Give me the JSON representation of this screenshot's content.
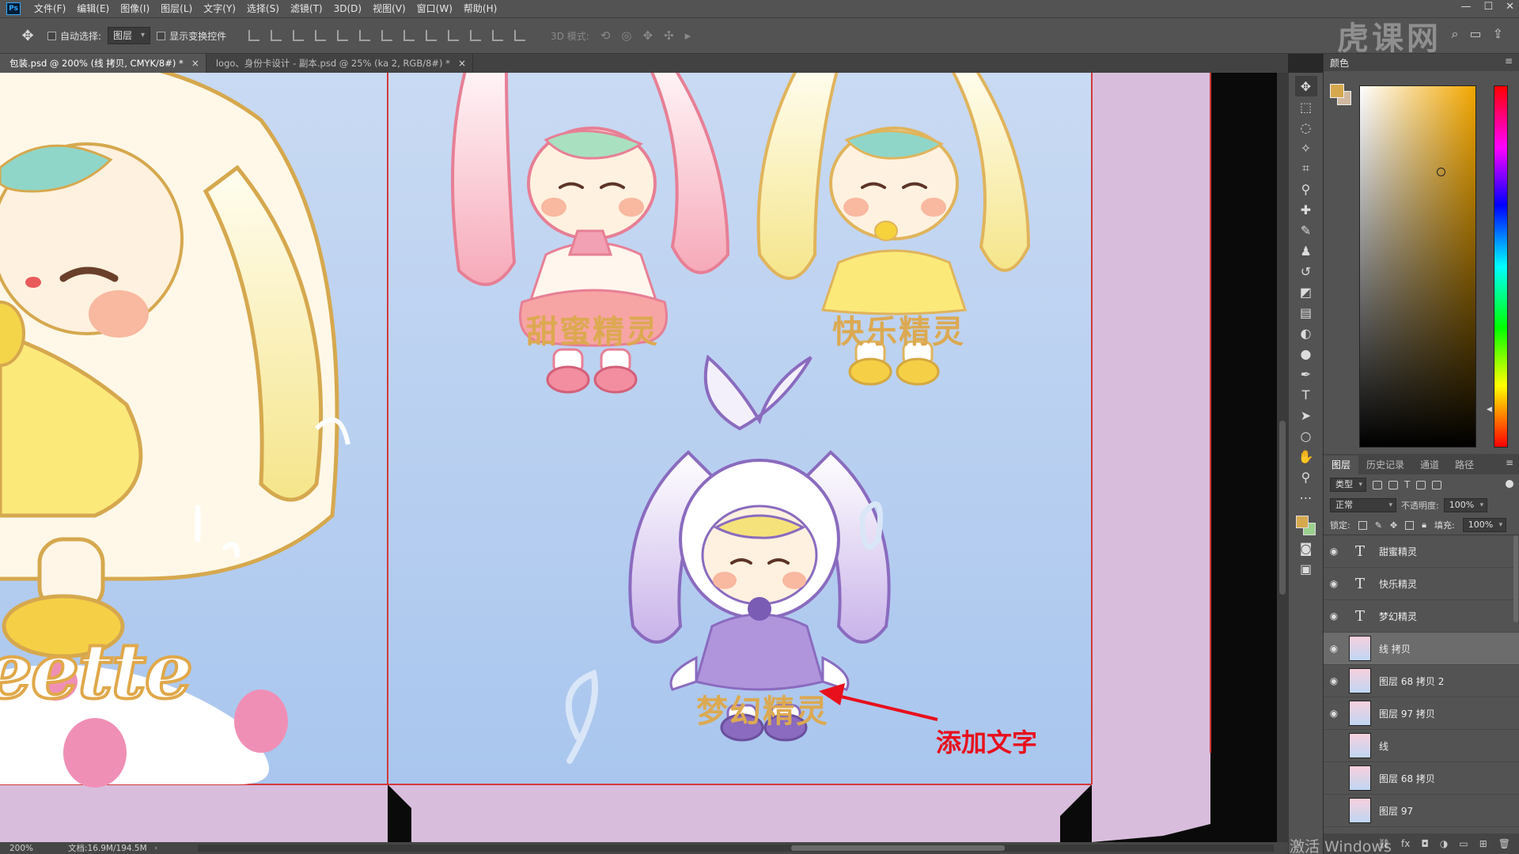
{
  "app": {
    "logo": "Ps",
    "menu": [
      "文件(F)",
      "编辑(E)",
      "图像(I)",
      "图层(L)",
      "文字(Y)",
      "选择(S)",
      "滤镜(T)",
      "3D(D)",
      "视图(V)",
      "窗口(W)",
      "帮助(H)"
    ],
    "window_controls": [
      "—",
      "☐",
      "✕"
    ]
  },
  "options": {
    "auto_select_label": "自动选择:",
    "auto_select_value": "图层",
    "show_transform_label": "显示变换控件",
    "mode_3d_label": "3D 模式:"
  },
  "tabs": [
    {
      "label": "包装.psd @ 200% (线 拷贝, CMYK/8#) *",
      "close": "×",
      "active": true
    },
    {
      "label": "logo、身份卡设计 - 副本.psd @ 25% (ka 2, RGB/8#) *",
      "close": "×",
      "active": false
    }
  ],
  "canvas": {
    "labels": {
      "sweet": "甜蜜精灵",
      "happy": "快乐精灵",
      "dream": "梦幻精灵"
    },
    "annotation": "添加文字",
    "partial_text": "eette"
  },
  "status": {
    "zoom": "200%",
    "doc_info": "文档:16.9M/194.5M",
    "arrow": "›"
  },
  "panels": {
    "color_title": "颜色",
    "layer_tabs": [
      "图层",
      "历史记录",
      "通道",
      "路径"
    ],
    "filter_kind": "类型",
    "blend_mode": "正常",
    "opacity_label": "不透明度:",
    "opacity_value": "100%",
    "lock_label": "锁定:",
    "fill_label": "填充:",
    "fill_value": "100%",
    "layers": [
      {
        "name": "甜蜜精灵",
        "type": "text",
        "visible": true,
        "selected": false
      },
      {
        "name": "快乐精灵",
        "type": "text",
        "visible": true,
        "selected": false
      },
      {
        "name": "梦幻精灵",
        "type": "text",
        "visible": true,
        "selected": false
      },
      {
        "name": "线 拷贝",
        "type": "image",
        "visible": true,
        "selected": true
      },
      {
        "name": "图层 68 拷贝 2",
        "type": "image",
        "visible": true,
        "selected": false
      },
      {
        "name": "图层 97 拷贝",
        "type": "image",
        "visible": true,
        "selected": false
      },
      {
        "name": "线",
        "type": "image",
        "visible": false,
        "selected": false
      },
      {
        "name": "图层 68 拷贝",
        "type": "image",
        "visible": false,
        "selected": false
      },
      {
        "name": "图层 97",
        "type": "image",
        "visible": false,
        "selected": false
      }
    ]
  },
  "colors": {
    "foreground": "#d6a84e",
    "label_gold": "#dca951",
    "annotation_red": "#e8101c",
    "canvas_blue": "#b8d0f0",
    "flap_purple": "#d8bedc"
  },
  "watermark": {
    "activate_windows": "激活 Windows",
    "logo_text": "虎课网"
  }
}
